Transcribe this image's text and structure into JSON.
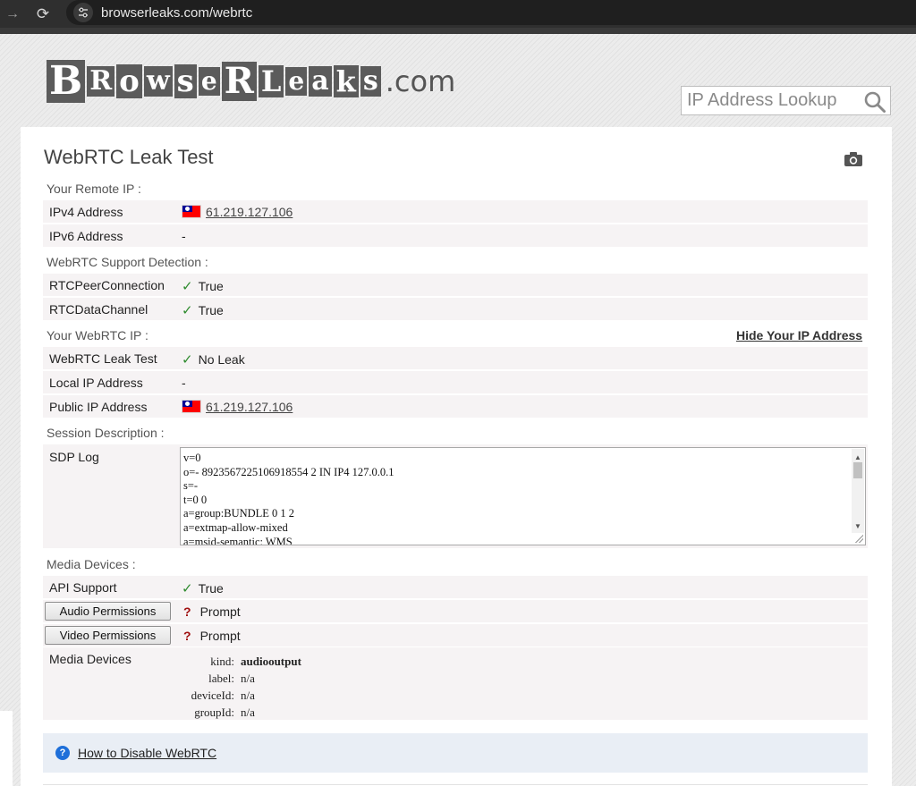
{
  "browser": {
    "url": "browserleaks.com/webrtc"
  },
  "header": {
    "logo_letters": [
      "B",
      "R",
      "o",
      "w",
      "s",
      "e",
      "R",
      "L",
      "e",
      "a",
      "k",
      "s"
    ],
    "logo_tail": ".com",
    "search_placeholder": "IP Address Lookup"
  },
  "page": {
    "title": "WebRTC Leak Test"
  },
  "remote_ip": {
    "label": "Your Remote IP :",
    "ipv4_key": "IPv4 Address",
    "ipv4_value": "61.219.127.106",
    "ipv6_key": "IPv6 Address",
    "ipv6_value": "-"
  },
  "support": {
    "label": "WebRTC Support Detection :",
    "peer_key": "RTCPeerConnection",
    "peer_value": "True",
    "data_key": "RTCDataChannel",
    "data_value": "True"
  },
  "webrtc_ip": {
    "label": "Your WebRTC IP :",
    "hide_link": "Hide Your IP Address",
    "leak_key": "WebRTC Leak Test",
    "leak_value": "No Leak",
    "local_key": "Local IP Address",
    "local_value": "-",
    "public_key": "Public IP Address",
    "public_value": "61.219.127.106"
  },
  "session": {
    "label": "Session Description :",
    "sdp_key": "SDP Log",
    "sdp_lines": [
      "v=0",
      "o=- 8923567225106918554 2 IN IP4 127.0.0.1",
      "s=-",
      "t=0 0",
      "a=group:BUNDLE 0 1 2",
      "a=extmap-allow-mixed",
      "a=msid-semantic: WMS"
    ]
  },
  "media": {
    "label": "Media Devices :",
    "api_key": "API Support",
    "api_value": "True",
    "audio_button": "Audio Permissions",
    "audio_value": "Prompt",
    "video_button": "Video Permissions",
    "video_value": "Prompt",
    "devices_key": "Media Devices",
    "devices": [
      {
        "key": "kind:",
        "value": "audiooutput"
      },
      {
        "key": "label:",
        "value": "n/a"
      },
      {
        "key": "deviceId:",
        "value": "n/a"
      },
      {
        "key": "groupId:",
        "value": "n/a"
      }
    ]
  },
  "howto": {
    "link": "How to Disable WebRTC"
  },
  "colors": {
    "row_bg": "#f6f3f4",
    "check_green": "#2e8b2e",
    "question_red": "#a01010",
    "help_blue": "#1e6fd9"
  }
}
